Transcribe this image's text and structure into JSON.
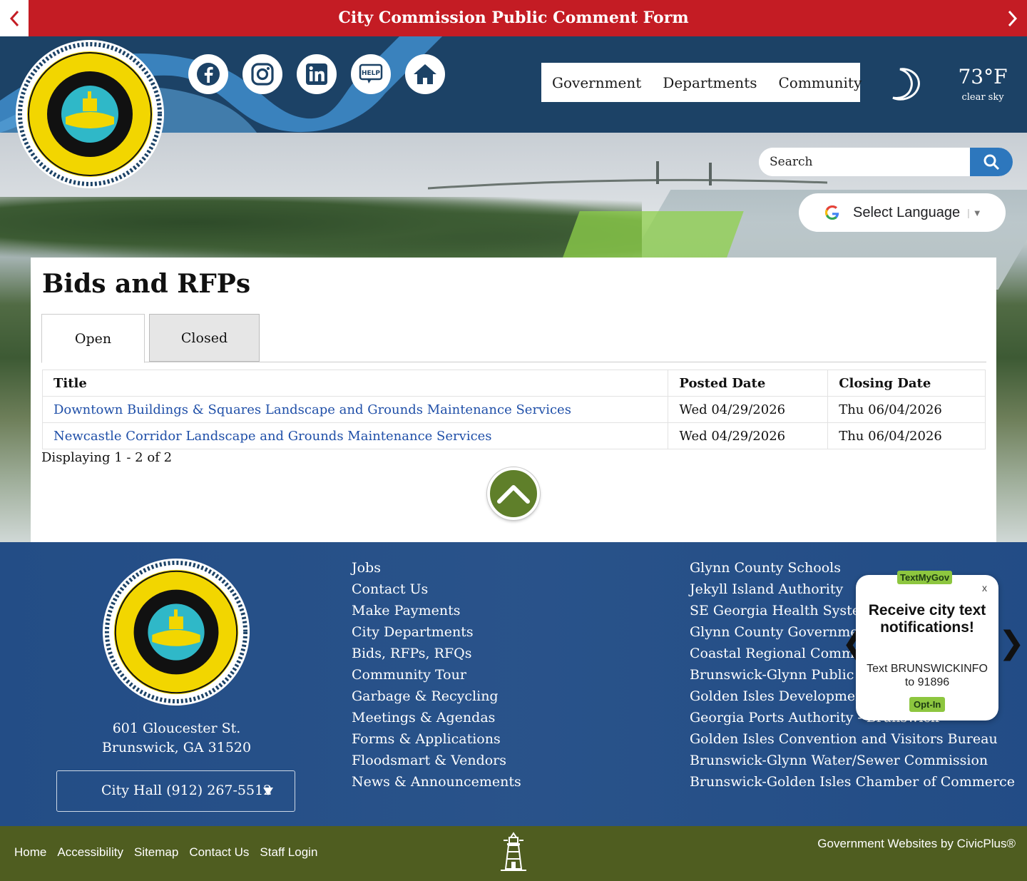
{
  "alert": {
    "title": "City Commission Public Comment Form"
  },
  "nav": {
    "items": [
      "Government",
      "Departments",
      "Community"
    ]
  },
  "social": [
    {
      "name": "facebook-icon"
    },
    {
      "name": "instagram-icon"
    },
    {
      "name": "linkedin-icon"
    },
    {
      "name": "help-icon"
    },
    {
      "name": "home-icon"
    }
  ],
  "weather": {
    "temperature": "73°F",
    "condition": "clear sky",
    "icon": "moon-icon"
  },
  "search": {
    "placeholder": "Search"
  },
  "language": {
    "label": "Select Language"
  },
  "main": {
    "title": "Bids and RFPs",
    "tabs": [
      "Open",
      "Closed"
    ],
    "table": {
      "headers": [
        "Title",
        "Posted Date",
        "Closing Date"
      ],
      "rows": [
        [
          "Downtown Buildings & Squares Landscape and Grounds Maintenance Services",
          "Wed 04/29/2026",
          "Thu 06/04/2026"
        ],
        [
          "Newcastle Corridor Landscape and Grounds Maintenance Services",
          "Wed 04/29/2026",
          "Thu 06/04/2026"
        ]
      ]
    },
    "display_count": "Displaying 1 - 2 of 2"
  },
  "footer": {
    "address_line1": "601 Gloucester St.",
    "address_line2": "Brunswick, GA 31520",
    "phone_select": "City Hall (912) 267-5512",
    "links_col1": [
      "Jobs",
      "Contact Us",
      "Make Payments",
      "City Departments",
      "Bids, RFPs, RFQs",
      "Community Tour",
      "Garbage & Recycling",
      "Meetings & Agendas",
      "Forms & Applications",
      "Floodsmart & Vendors",
      "News & Announcements"
    ],
    "links_col2": [
      "Glynn County Schools",
      "Jekyll Island Authority",
      "SE Georgia Health System",
      "Glynn County Government",
      "Coastal Regional Commission",
      "Brunswick-Glynn Public Library",
      "Golden Isles Development Authority",
      "Georgia Ports Authority - Brunswick",
      "Golden Isles Convention and Visitors Bureau",
      "Brunswick-Glynn Water/Sewer Commission",
      "Brunswick-Golden Isles Chamber of Commerce"
    ]
  },
  "textmygov": {
    "badge": "TextMyGov",
    "close": "x",
    "headline": "Receive city text notifications!",
    "body": "Text BRUNSWICKINFO to 91896",
    "optin": "Opt-In"
  },
  "bottom": {
    "links": [
      "Home",
      "Accessibility",
      "Sitemap",
      "Contact Us",
      "Staff Login"
    ],
    "credit": "Government Websites by CivicPlus®"
  },
  "colors": {
    "alert_red": "#c41c24",
    "header_navy": "#1c4266",
    "footer_blue": "#234d86",
    "bottom_olive": "#4f5d20",
    "link_blue": "#1f4fa8",
    "seal_yellow": "#f2d600"
  }
}
